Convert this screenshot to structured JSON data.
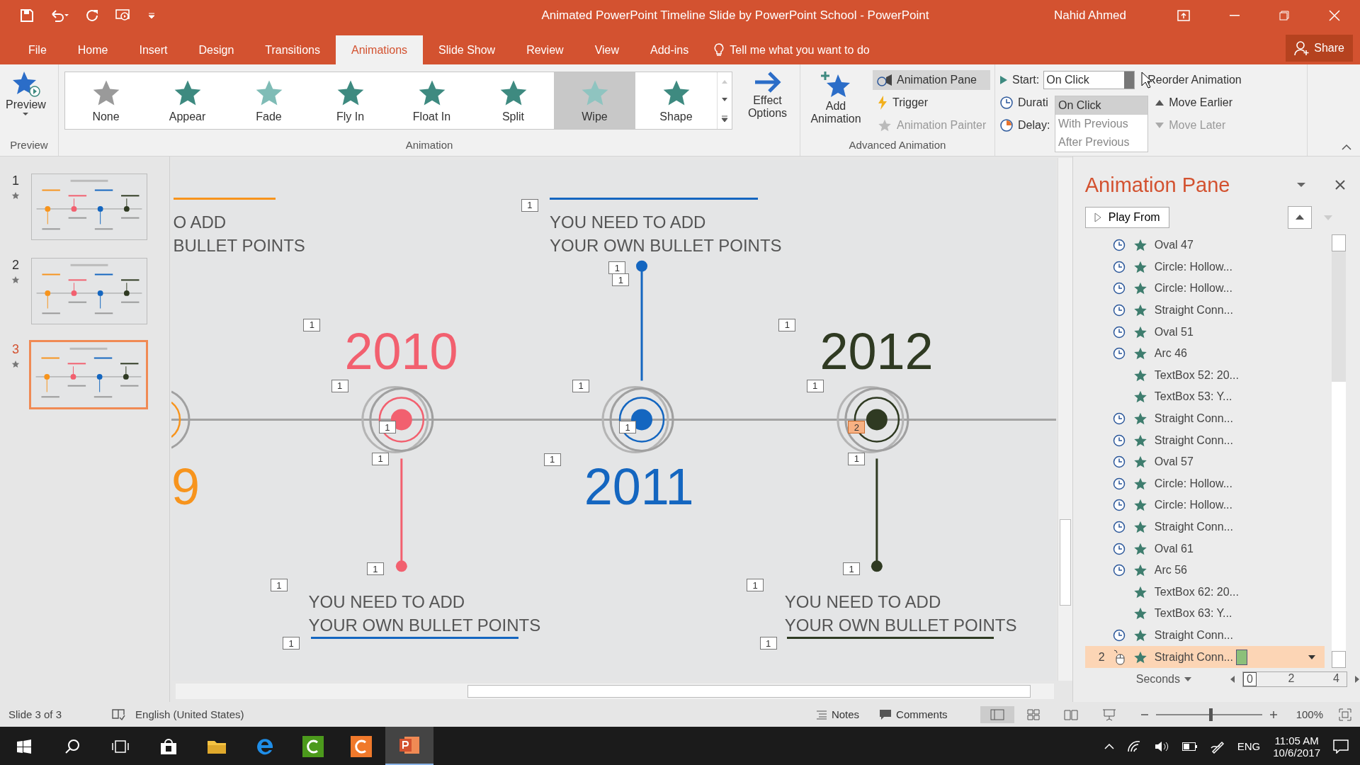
{
  "window": {
    "title": "Animated PowerPoint Timeline Slide by PowerPoint School  -  PowerPoint",
    "user": "Nahid Ahmed"
  },
  "tabs": [
    {
      "label": "File",
      "selected": false
    },
    {
      "label": "Home",
      "selected": false
    },
    {
      "label": "Insert",
      "selected": false
    },
    {
      "label": "Design",
      "selected": false
    },
    {
      "label": "Transitions",
      "selected": false
    },
    {
      "label": "Animations",
      "selected": true
    },
    {
      "label": "Slide Show",
      "selected": false
    },
    {
      "label": "Review",
      "selected": false
    },
    {
      "label": "View",
      "selected": false
    },
    {
      "label": "Add-ins",
      "selected": false
    }
  ],
  "tell_me": {
    "placeholder": "Tell me what you want to do"
  },
  "share": "Share",
  "ribbon": {
    "preview": {
      "label": "Preview",
      "group": "Preview"
    },
    "animations": [
      {
        "label": "None",
        "kind": "none",
        "selected": false
      },
      {
        "label": "Appear",
        "kind": "appear",
        "selected": false
      },
      {
        "label": "Fade",
        "kind": "fade",
        "selected": false
      },
      {
        "label": "Fly In",
        "kind": "flyin",
        "selected": false
      },
      {
        "label": "Float In",
        "kind": "floatin",
        "selected": false
      },
      {
        "label": "Split",
        "kind": "split",
        "selected": false
      },
      {
        "label": "Wipe",
        "kind": "wipe",
        "selected": true
      },
      {
        "label": "Shape",
        "kind": "shape",
        "selected": false
      }
    ],
    "effect_options": "Effect Options",
    "animation_group": "Animation",
    "add_animation": "Add Animation",
    "advanced": [
      {
        "label": "Animation Pane",
        "kind": "pane",
        "disabled": false,
        "selected": true
      },
      {
        "label": "Trigger",
        "kind": "trigger",
        "disabled": false,
        "selected": false
      },
      {
        "label": "Animation Painter",
        "kind": "painter",
        "disabled": true,
        "selected": false
      }
    ],
    "advanced_group": "Advanced Animation",
    "timing": {
      "start_label": "Start:",
      "start_value": "On Click",
      "duration_label": "Durati",
      "delay_label": "Delay:",
      "options": [
        {
          "label": "On Click",
          "selected": true
        },
        {
          "label": "With Previous",
          "selected": false
        },
        {
          "label": "After Previous",
          "selected": false
        }
      ],
      "reorder": "Reorder Animation",
      "moves": [
        {
          "label": "Move Earlier",
          "kind": "earlier",
          "disabled": false
        },
        {
          "label": "Move Later",
          "kind": "later",
          "disabled": true
        }
      ]
    }
  },
  "slides": [
    {
      "number": "1",
      "selected": false
    },
    {
      "number": "2",
      "selected": false
    },
    {
      "number": "3",
      "selected": true
    }
  ],
  "slide": {
    "milestones": [
      {
        "year": "9",
        "color": "#f7941d"
      },
      {
        "year": "2010",
        "color": "#f2606f"
      },
      {
        "year": "2011",
        "color": "#1466c0"
      },
      {
        "year": "2012",
        "color": "#2f3a22"
      }
    ],
    "bullets": [
      {
        "text": "O ADD\nBULLET POINTS",
        "color": "#f7941d"
      },
      {
        "text": "YOU NEED TO ADD\nYOUR OWN BULLET POINTS",
        "color": "#1466c0"
      },
      {
        "text": "YOU NEED TO ADD\nYOUR OWN BULLET POINTS",
        "color": "#1466c0"
      },
      {
        "text": "YOU NEED TO ADD\nYOUR OWN BULLET POINTS",
        "color": "#2f3a22"
      }
    ],
    "tags": [
      {
        "label": "1",
        "selected": false
      },
      {
        "label": "1",
        "selected": false
      },
      {
        "label": "1",
        "selected": false
      },
      {
        "label": "1",
        "selected": false
      },
      {
        "label": "1",
        "selected": false
      },
      {
        "label": "1",
        "selected": false
      },
      {
        "label": "1",
        "selected": false
      },
      {
        "label": "1",
        "selected": false
      },
      {
        "label": "1",
        "selected": false
      },
      {
        "label": "1",
        "selected": false
      },
      {
        "label": "1",
        "selected": false
      },
      {
        "label": "1",
        "selected": false
      },
      {
        "label": "2",
        "selected": true
      },
      {
        "label": "1",
        "selected": false
      },
      {
        "label": "1",
        "selected": false
      },
      {
        "label": "1",
        "selected": false
      },
      {
        "label": "1",
        "selected": false
      },
      {
        "label": "1",
        "selected": false
      },
      {
        "label": "1",
        "selected": false
      },
      {
        "label": "1",
        "selected": false
      }
    ]
  },
  "animation_pane": {
    "title": "Animation Pane",
    "play_from": "Play From",
    "items": [
      {
        "name": "Oval 47",
        "kind": "after",
        "selected": false
      },
      {
        "name": "Circle: Hollow...",
        "kind": "after",
        "selected": false
      },
      {
        "name": "Circle: Hollow...",
        "kind": "after",
        "selected": false
      },
      {
        "name": "Straight Conn...",
        "kind": "after",
        "selected": false
      },
      {
        "name": "Oval 51",
        "kind": "after",
        "selected": false
      },
      {
        "name": "Arc 46",
        "kind": "after",
        "selected": false
      },
      {
        "name": "TextBox 52: 20...",
        "kind": "with",
        "selected": false
      },
      {
        "name": "TextBox 53: Y...",
        "kind": "with",
        "selected": false
      },
      {
        "name": "Straight Conn...",
        "kind": "after",
        "selected": false
      },
      {
        "name": "Straight Conn...",
        "kind": "after",
        "selected": false
      },
      {
        "name": "Oval 57",
        "kind": "after",
        "selected": false
      },
      {
        "name": "Circle: Hollow...",
        "kind": "after",
        "selected": false
      },
      {
        "name": "Circle: Hollow...",
        "kind": "after",
        "selected": false
      },
      {
        "name": "Straight Conn...",
        "kind": "after",
        "selected": false
      },
      {
        "name": "Oval 61",
        "kind": "after",
        "selected": false
      },
      {
        "name": "Arc 56",
        "kind": "after",
        "selected": false
      },
      {
        "name": "TextBox 62: 20...",
        "kind": "with",
        "selected": false
      },
      {
        "name": "TextBox 63: Y...",
        "kind": "with",
        "selected": false
      },
      {
        "name": "Straight Conn...",
        "kind": "after",
        "selected": false
      },
      {
        "number": "2",
        "name": "Straight Conn...",
        "kind": "click",
        "selected": true
      }
    ],
    "timeline": {
      "unit": "Seconds",
      "ticks": [
        "0",
        "2",
        "4"
      ]
    }
  },
  "status_bar": {
    "slide": "Slide 3 of 3",
    "language": "English (United States)",
    "notes": "Notes",
    "comments": "Comments",
    "zoom": "100%",
    "zoom_slider": {
      "level": 0.5
    }
  },
  "taskbar": {
    "language": "ENG",
    "time": "11:05 AM",
    "date": "10/6/2017"
  }
}
